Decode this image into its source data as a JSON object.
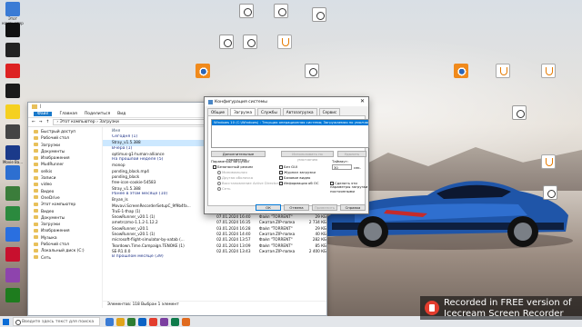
{
  "desktop": {
    "left_icons": [
      {
        "label": "Этот компьютер",
        "color": "#3a7bd5"
      },
      {
        "label": "",
        "color": "#111"
      },
      {
        "label": "",
        "color": "#222"
      },
      {
        "label": "",
        "color": "#d22"
      },
      {
        "label": "",
        "color": "#1a1a1a"
      },
      {
        "label": "",
        "color": "#f5d020"
      },
      {
        "label": "",
        "color": "#444"
      },
      {
        "label": "Movie Ba...",
        "color": "#1b3a8a"
      },
      {
        "label": "",
        "color": "#2d6fd1"
      },
      {
        "label": "",
        "color": "#3b7d3b"
      },
      {
        "label": "",
        "color": "#2b8a3e"
      },
      {
        "label": "",
        "color": "#2a6fe0"
      },
      {
        "label": "",
        "color": "#c8102e"
      },
      {
        "label": "",
        "color": "#8e44ad"
      },
      {
        "label": "",
        "color": "#1e7c1e"
      }
    ],
    "right_icons": [
      {
        "type": "doc"
      },
      {
        "type": "doc"
      },
      {
        "type": "doc"
      },
      {
        "type": "doc"
      },
      {
        "type": "doc"
      },
      {
        "type": "java"
      },
      {
        "type": "doc"
      },
      {
        "type": "blender"
      },
      {
        "type": "blender"
      },
      {
        "type": "java"
      },
      {
        "type": "java"
      },
      {
        "type": "doc"
      },
      {
        "type": "java"
      },
      {
        "type": "doc"
      }
    ]
  },
  "explorer": {
    "ribbon": [
      "Файл",
      "Главная",
      "Поделиться",
      "Вид"
    ],
    "address": "› Этот компьютер › Загрузки",
    "nav": [
      "Быстрый доступ",
      "Рабочий стол",
      "Загрузки",
      "Документы",
      "Изображения",
      "MudRunner",
      "selkis",
      "Записи",
      "video",
      "Видео",
      "OneDrive",
      "Этот компьютер",
      "Видео",
      "Документы",
      "Загрузки",
      "Изображения",
      "Музыка",
      "Рабочий стол",
      "Локальный диск (C:)",
      "Сеть"
    ],
    "col_name": "Имя",
    "rows": [
      {
        "g": true,
        "n": "Сегодня (1)"
      },
      {
        "n": "Stray_v1.5.388",
        "sel": true
      },
      {
        "g": true,
        "n": "Вчера (1)"
      },
      {
        "n": "optimus-g1-human-alliance"
      },
      {
        "g": true,
        "n": "На прошлой неделе (5)"
      },
      {
        "n": "monop"
      },
      {
        "n": "ponding_black.mp4"
      },
      {
        "n": "ponding_black"
      },
      {
        "n": "free-icon-cookie-54583"
      },
      {
        "n": "Stray_v1.5.388"
      },
      {
        "g": true,
        "n": "Ранее в этом месяце (10)"
      },
      {
        "n": "Bryan_ls",
        "d": "07.01.2024 16:55",
        "t": "Приложение",
        "s": "27 901 КБ"
      },
      {
        "n": "Movavi.ScreenRecorderSetupC_9f9b4fa...",
        "d": "07.01.2024 16:46",
        "t": "Приложение",
        "s": "4 896 КБ"
      },
      {
        "n": "TruE-1-thap (1)",
        "d": "07.01.2024 16:25",
        "t": "Сжатая ZIP-папка",
        "s": "98 536 КБ"
      },
      {
        "n": "SnowRunner_v20.1 (1)",
        "d": "07.01.2024 16:40",
        "t": "Файл \"TORRENT\"",
        "s": "29 КБ"
      },
      {
        "n": "ametrczmo-1.1.2-1.12.2",
        "d": "07.01.2024 16:35",
        "t": "Сжатая ZIP-папка",
        "s": "2 734 КБ"
      },
      {
        "n": "SnowRunner_v20.1",
        "d": "03.01.2024 16:28",
        "t": "Файл \"TORRENT\"",
        "s": "29 КБ"
      },
      {
        "n": "SnowRunner_v20.1 (1)",
        "d": "02.01.2024 14:40",
        "t": "Сжатая ZIP-папка",
        "s": "40 КБ"
      },
      {
        "n": "microsoft-flight-simulator-by-xatab (...",
        "d": "02.01.2024 13:57",
        "t": "Файл \"TORRENT\"",
        "s": "282 КБ"
      },
      {
        "n": "Teardown.Time.Campaign.TENOKE (1)",
        "d": "02.01.2024 13:09",
        "t": "Файл \"TORRENT\"",
        "s": "85 КБ"
      },
      {
        "n": "SE-R1.0.0",
        "d": "02.01.2024 13:43",
        "t": "Сжатая ZIP-папка",
        "s": "2 400 КБ"
      },
      {
        "g": true,
        "n": "В прошлом месяце (39)"
      }
    ],
    "status": "Элементов: 118   Выбран 1 элемент"
  },
  "msconfig": {
    "title": "Конфигурация системы",
    "tabs": [
      "Общие",
      "Загрузка",
      "Службы",
      "Автозагрузка",
      "Сервис"
    ],
    "boot_entry": "Windows 10 (C:\\Windows) : Текущая операционная система; Загружаемая по умолчанию ОС",
    "advanced_btn": "Дополнительные параметры...",
    "default_btn": "Использовать по умолчанию",
    "delete_btn": "Удалить",
    "boot_options_label": "Параметры загрузки",
    "safe_mode": "Безопасный режим",
    "minimal": "Минимальная",
    "alt_shell": "Другая оболочка",
    "ad_repair": "Восстановление Active Directory",
    "network": "Сеть",
    "no_gui": "Без GUI",
    "boot_log": "Журнал загрузки",
    "base_video": "Базовое видео",
    "os_info": "Информация об ОС",
    "timeout_label": "Таймаут:",
    "timeout_value": "30",
    "timeout_unit": "сек.",
    "make_permanent": "Сделать эти параметры загрузки постоянными",
    "ok": "ОК",
    "cancel": "Отмена",
    "apply": "Применить",
    "help": "Справка"
  },
  "taskbar": {
    "search_placeholder": "Введите здесь текст для поиска",
    "apps": [
      "#3a7bd5",
      "#e1a41b",
      "#2e7d32",
      "#0b63c5",
      "#e33d2e",
      "#7b3fa0",
      "#0f7b4b",
      "#e06b1f"
    ],
    "time": "",
    "date": ""
  },
  "watermark": {
    "line1": "Recorded in FREE version of",
    "line2": "Icecream  Screen  Recorder"
  }
}
